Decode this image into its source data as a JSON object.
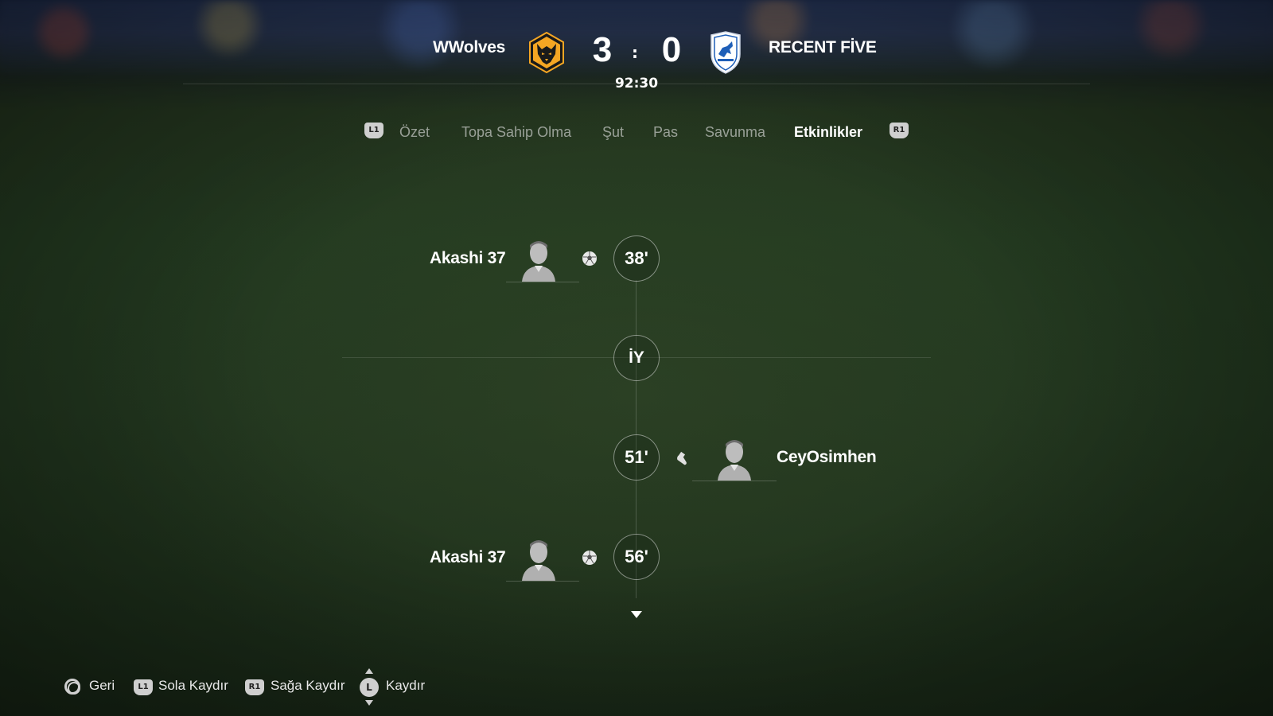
{
  "scoreboard": {
    "home_team": "WWolves",
    "away_team": "RECENT FİVE",
    "home_score": "3",
    "away_score": "0",
    "separator": ":",
    "clock": "92:30",
    "home_crest_icon": "wolf-crest-icon",
    "away_crest_icon": "shield-crest-icon"
  },
  "tabs": {
    "left_button": "L1",
    "right_button": "R1",
    "items": [
      {
        "label": "Özet",
        "active": false
      },
      {
        "label": "Topa Sahip Olma",
        "active": false
      },
      {
        "label": "Şut",
        "active": false
      },
      {
        "label": "Pas",
        "active": false
      },
      {
        "label": "Savunma",
        "active": false
      },
      {
        "label": "Etkinlikler",
        "active": true
      }
    ]
  },
  "timeline": {
    "events": [
      {
        "minute": "38'",
        "player": "Akashi 37",
        "side": "home",
        "icon": "goal-soccer-ball-icon"
      },
      {
        "minute": "İY",
        "player": "",
        "side": "center",
        "icon": ""
      },
      {
        "minute": "51'",
        "player": "CeyOsimhen",
        "side": "away",
        "icon": "assist-boot-icon"
      },
      {
        "minute": "56'",
        "player": "Akashi 37",
        "side": "home",
        "icon": "goal-soccer-ball-icon"
      }
    ]
  },
  "footer": {
    "back_label": "Geri",
    "scroll_left_button": "L1",
    "scroll_left_label": "Sola Kaydır",
    "scroll_right_button": "R1",
    "scroll_right_label": "Sağa Kaydır",
    "stick_button": "L",
    "scroll_label": "Kaydır"
  },
  "colors": {
    "wolves_gold": "#F5A623",
    "away_blue": "#1f5fb8",
    "text": "#ffffff"
  }
}
